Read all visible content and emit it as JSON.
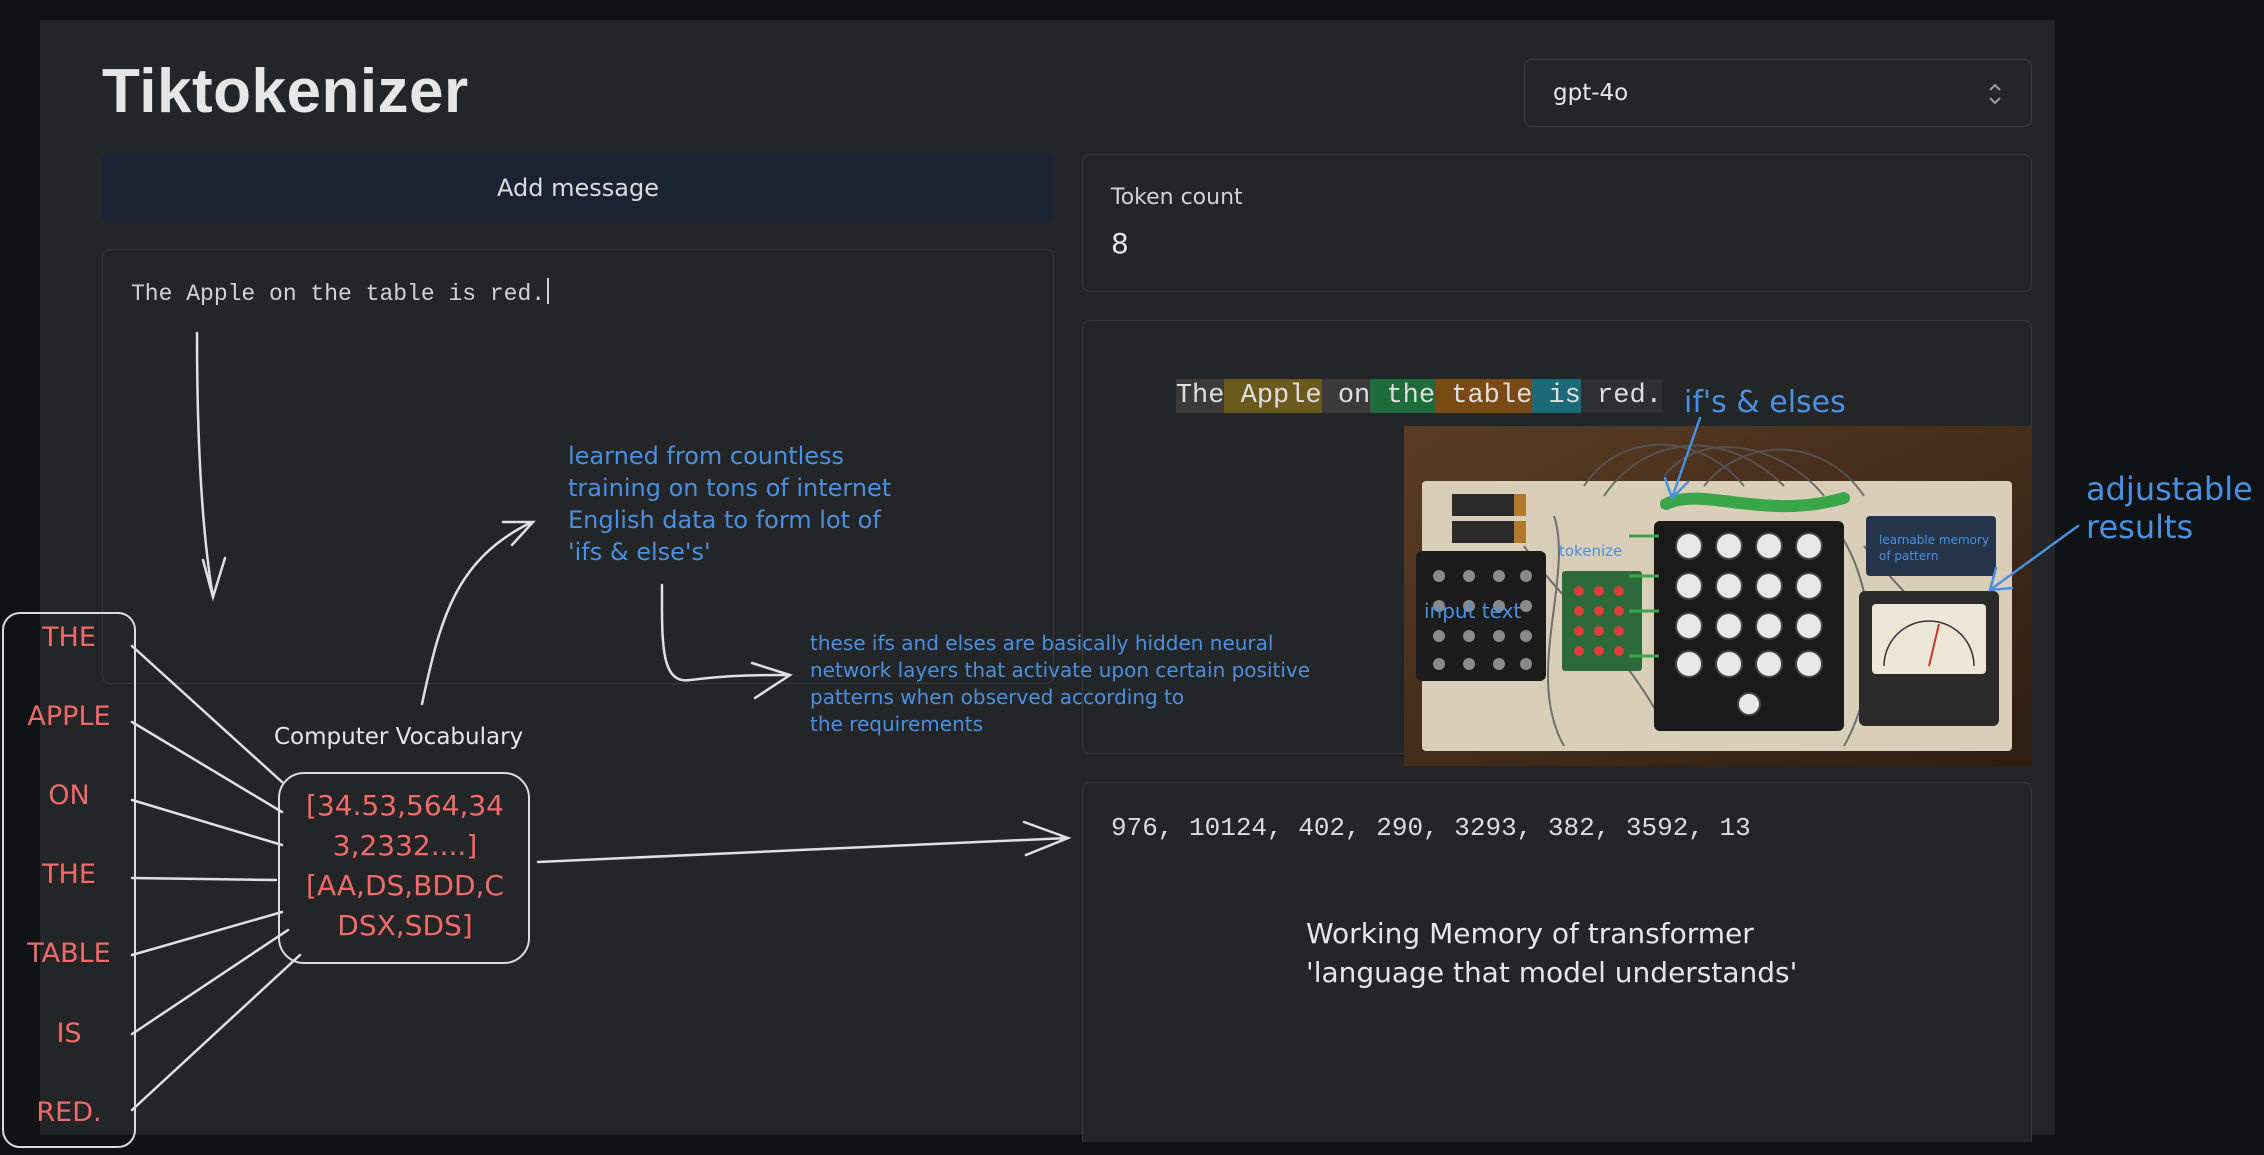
{
  "app": {
    "title": "Tiktokenizer"
  },
  "model_select": {
    "value": "gpt-4o"
  },
  "buttons": {
    "add_message": "Add message"
  },
  "editor": {
    "text": "The Apple on the table is red."
  },
  "token_count": {
    "label": "Token count",
    "value": "8"
  },
  "tokens": [
    {
      "text": "The",
      "color": "#3a3a3a"
    },
    {
      "text": " Apple",
      "color": "#6b5a1e"
    },
    {
      "text": " on",
      "color": "#3a3a3a"
    },
    {
      "text": " the",
      "color": "#1e6b3c"
    },
    {
      "text": " table",
      "color": "#7a4a14"
    },
    {
      "text": " is",
      "color": "#1a6a78"
    },
    {
      "text": " red.",
      "color": "#2d2f31"
    }
  ],
  "token_ids": "976, 10124, 402, 290, 3293, 382, 3592, 13",
  "annotations": {
    "learned": [
      "learned from countless",
      "training on tons of internet",
      "English data to form lot of",
      "'ifs & else's'"
    ],
    "hidden_layers": [
      "these ifs and elses are basically hidden neural",
      "network layers that activate upon certain positive",
      "patterns when observed according to",
      "the requirements"
    ],
    "ifs_elses": "if's & elses",
    "adjustable": [
      "adjustable",
      "results"
    ],
    "computer_vocabulary": "Computer Vocabulary",
    "vocab_content": [
      "[34.53,564,34",
      "3,2332....]",
      "[AA,DS,BDD,C",
      "DSX,SDS]"
    ],
    "working_memory": [
      "Working Memory of transformer",
      "'language that model understands'"
    ],
    "words": [
      "THE",
      "APPLE",
      "ON",
      "THE",
      "TABLE",
      "IS",
      "RED."
    ],
    "photo_labels": {
      "input_text": "input text",
      "tokenize": "tokenize",
      "learnable_memory": [
        "learnable memory",
        "of pattern"
      ]
    }
  }
}
